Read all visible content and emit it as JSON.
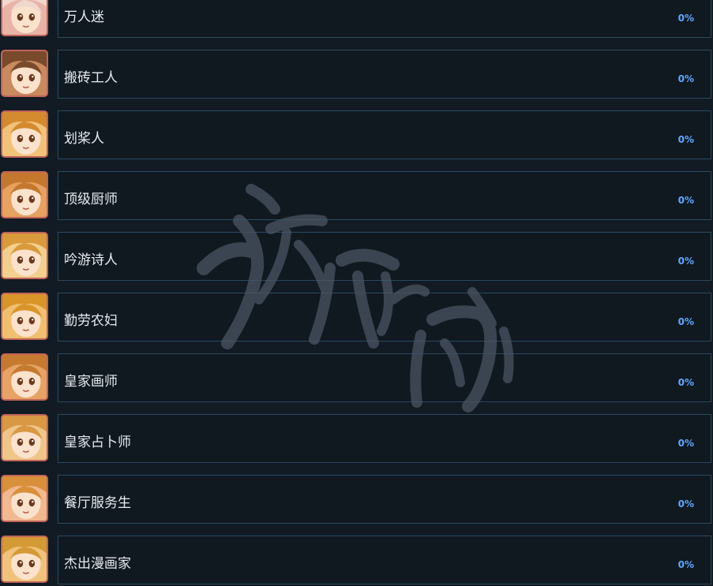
{
  "achievements": [
    {
      "title": "万人迷",
      "progress": "0%",
      "icon": "anime-girl-portrait-icon"
    },
    {
      "title": "搬砖工人",
      "progress": "0%",
      "icon": "anime-girl-portrait-icon"
    },
    {
      "title": "划桨人",
      "progress": "0%",
      "icon": "anime-girl-portrait-icon"
    },
    {
      "title": "顶级厨师",
      "progress": "0%",
      "icon": "anime-girl-portrait-icon"
    },
    {
      "title": "吟游诗人",
      "progress": "0%",
      "icon": "anime-girl-portrait-icon"
    },
    {
      "title": "勤劳农妇",
      "progress": "0%",
      "icon": "anime-girl-portrait-icon"
    },
    {
      "title": "皇家画师",
      "progress": "0%",
      "icon": "anime-girl-portrait-icon"
    },
    {
      "title": "皇家占卜师",
      "progress": "0%",
      "icon": "anime-girl-portrait-icon"
    },
    {
      "title": "餐厅服务生",
      "progress": "0%",
      "icon": "anime-girl-portrait-icon"
    },
    {
      "title": "杰出漫画家",
      "progress": "0%",
      "icon": "anime-girl-portrait-icon"
    }
  ],
  "watermark": {
    "text": "游侠网"
  },
  "colors": {
    "background": "#121a24",
    "bar_border": "#2b4a5e",
    "percent": "#5fa8ff",
    "avatar_border": "#c0655a"
  }
}
